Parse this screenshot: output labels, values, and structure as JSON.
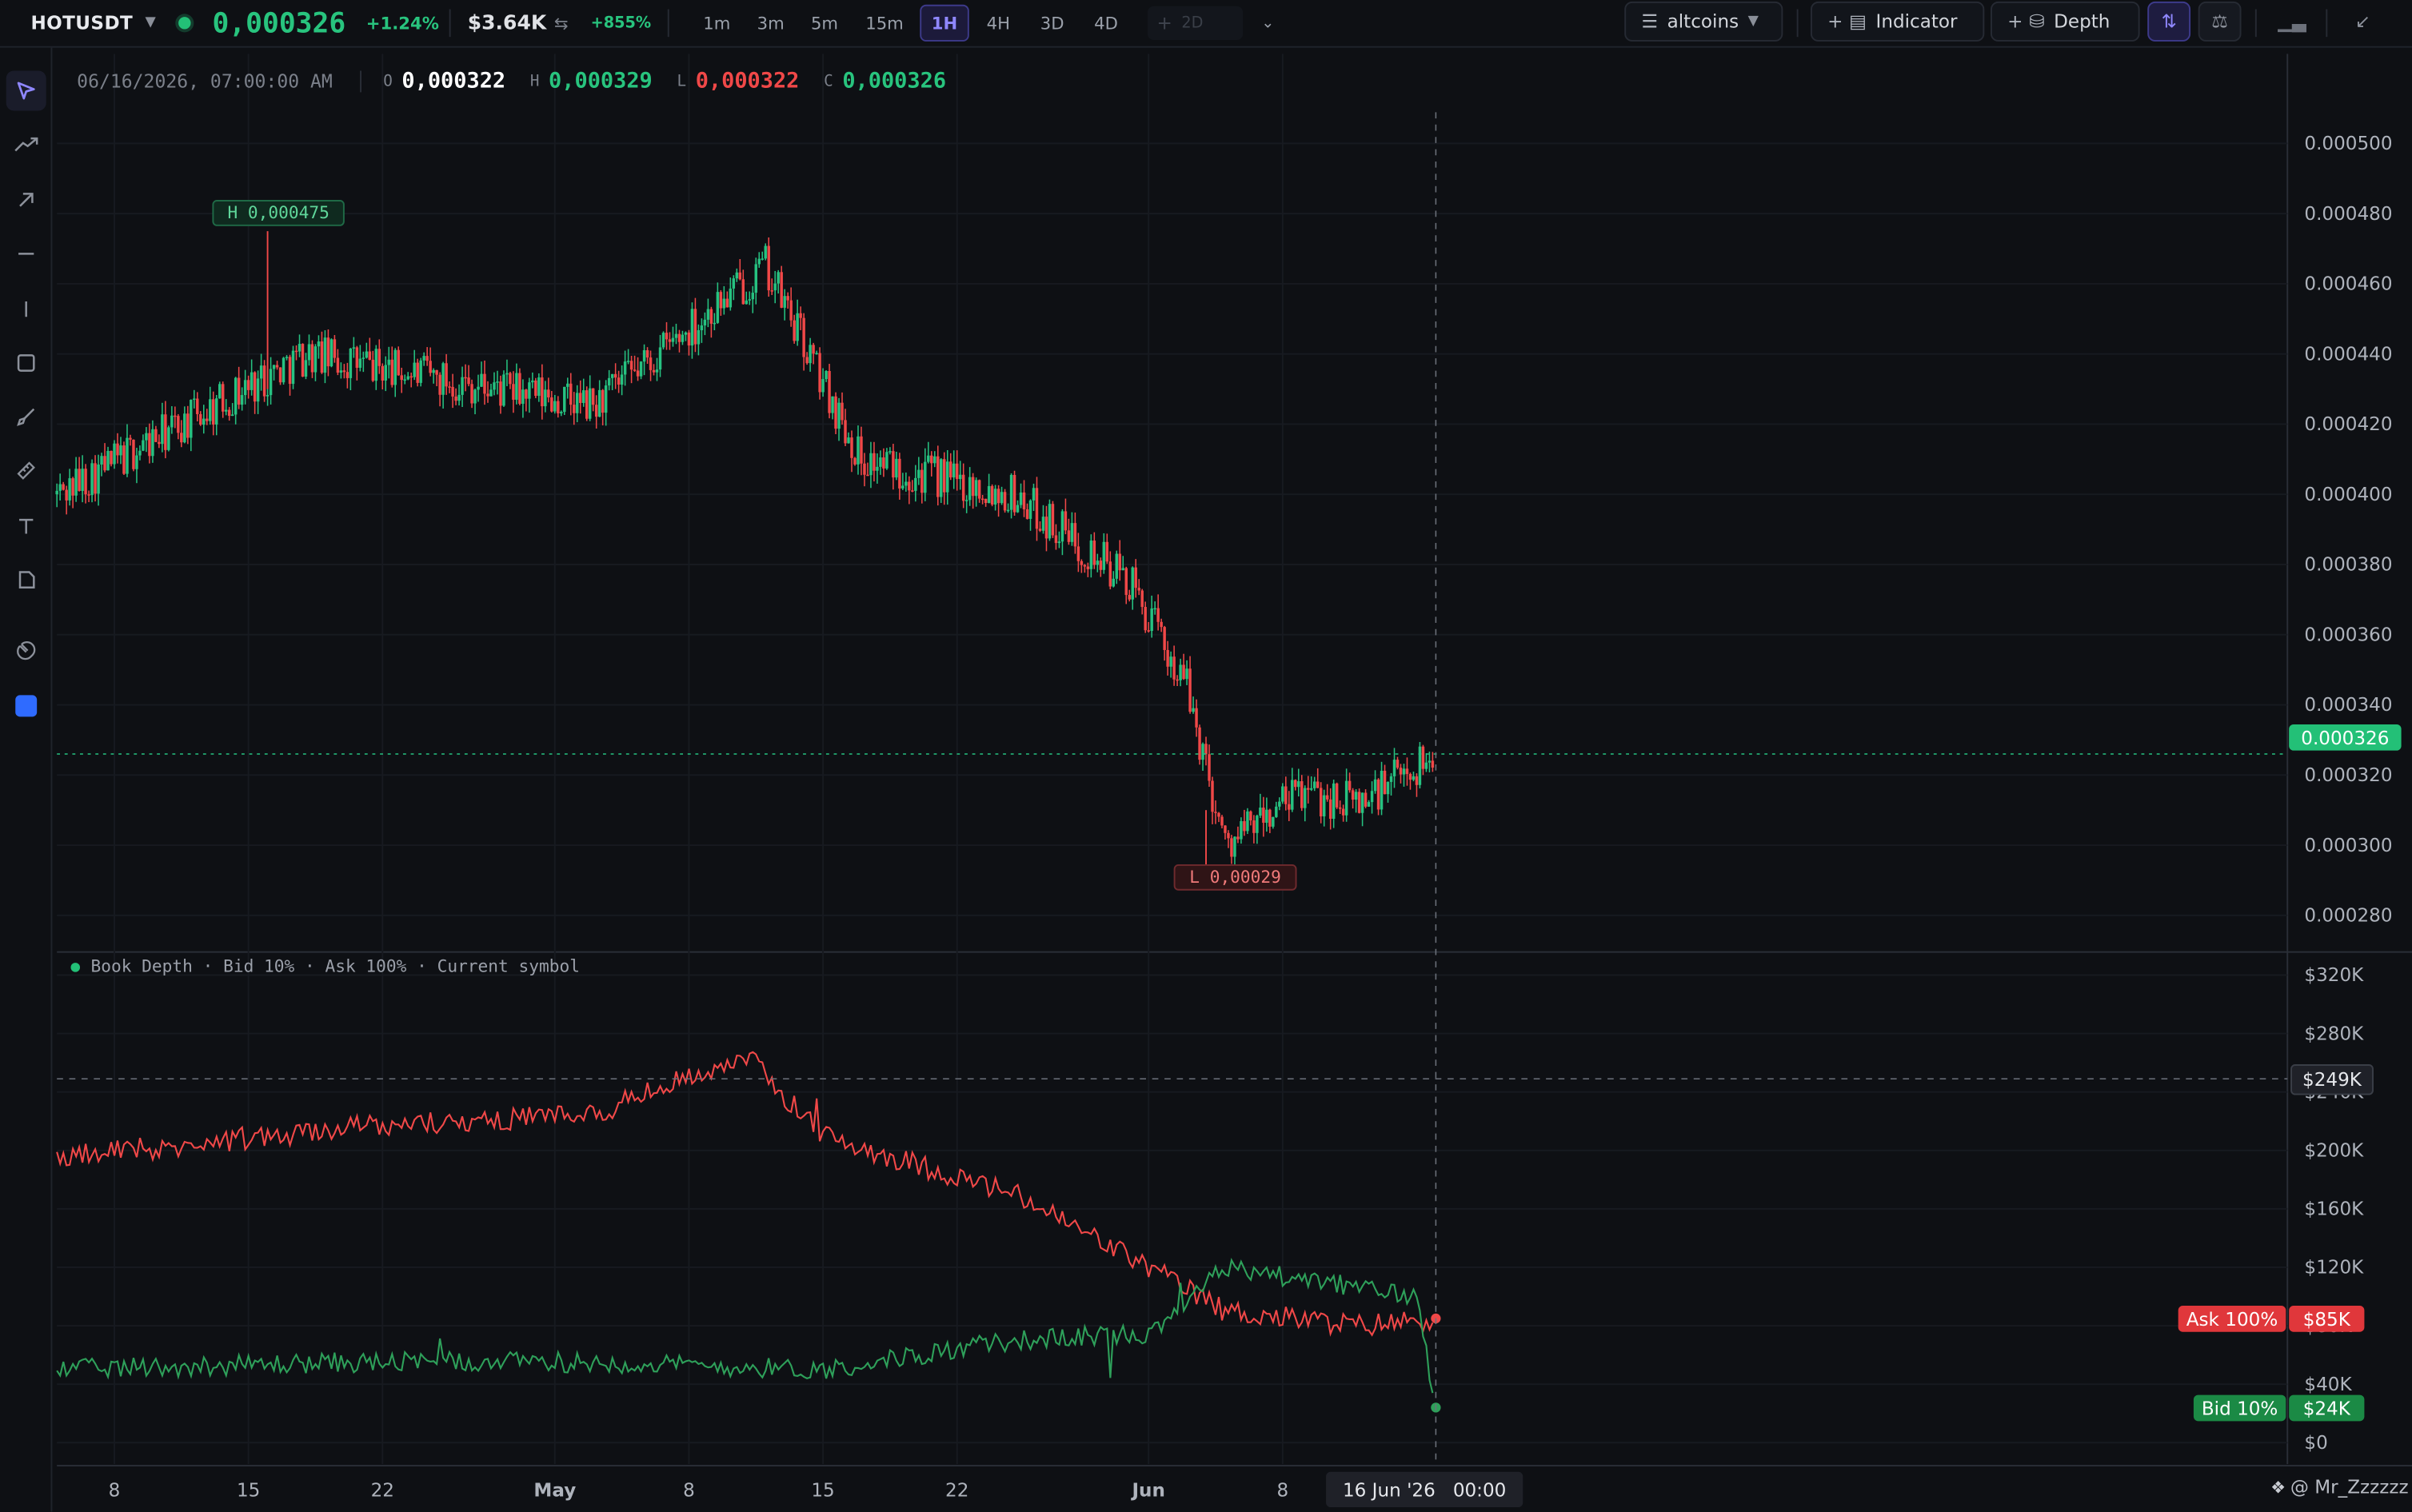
{
  "header": {
    "symbol": "HOTUSDT",
    "price": "0,000326",
    "change_pct": "+1.24%",
    "volume": "$3.64K",
    "volume_change": "+855%",
    "timeframes": [
      "1m",
      "3m",
      "5m",
      "15m",
      "1H",
      "4H",
      "3D",
      "4D"
    ],
    "active_timeframe": "1H",
    "add_timeframe": "2D",
    "category": "altcoins",
    "indicator_label": "Indicator",
    "depth_label": "Depth"
  },
  "ohlc": {
    "time": "06/16/2026, 07:00:00 AM",
    "o_label": "O",
    "o": "0,000322",
    "h_label": "H",
    "h": "0,000329",
    "l_label": "L",
    "l": "0,000322",
    "c_label": "C",
    "c": "0,000326"
  },
  "depth_legend": "Book Depth · Bid 10% · Ask 100% · Current symbol",
  "watermark": "@ Mr_Zzzzzz",
  "colors": {
    "up": "#26c281",
    "down": "#f04848",
    "ask": "#f04848",
    "bid": "#2ea05a",
    "accent": "#7b6cff",
    "background": "#0e1014"
  },
  "chart_data": [
    {
      "type": "candlestick",
      "series": [
        {
          "name": "HOTUSDT",
          "interval": "1H"
        }
      ],
      "x": [
        "2026-04-05",
        "2026-04-18",
        "2026-05-03",
        "2026-05-12",
        "2026-05-17",
        "2026-05-25",
        "2026-05-31",
        "2026-06-03",
        "2026-06-05",
        "2026-06-09",
        "2026-06-12",
        "2026-06-16"
      ],
      "close": [
        0.0004,
        0.00044,
        0.000425,
        0.000465,
        0.00041,
        0.0004,
        0.000375,
        0.000345,
        0.0003,
        0.000315,
        0.000312,
        0.000326
      ],
      "y_ticks": [
        "0.000500",
        "0.000480",
        "0.000460",
        "0.000440",
        "0.000420",
        "0.000400",
        "0.000380",
        "0.000360",
        "0.000340",
        "0.000320",
        "0.000300",
        "0.000280"
      ],
      "ylim": [
        0.00027,
        0.000508
      ],
      "last_price_label": "0.000326",
      "high_label": "H 0,000475",
      "low_label": "L 0,00029",
      "high": 0.000475,
      "low": 0.00029,
      "grid": true
    },
    {
      "type": "line",
      "title": "Book Depth · Bid 10% · Ask 100% · Current symbol",
      "series": [
        {
          "name": "Ask 100%",
          "x": [
            "2026-04-05",
            "2026-04-20",
            "2026-05-03",
            "2026-05-11",
            "2026-05-15",
            "2026-05-25",
            "2026-06-01",
            "2026-06-05",
            "2026-06-12",
            "2026-06-16"
          ],
          "values": [
            195000,
            215000,
            225000,
            265000,
            210000,
            170000,
            120000,
            90000,
            80000,
            85000
          ],
          "last_label": "$85K"
        },
        {
          "name": "Bid 10%",
          "x": [
            "2026-04-05",
            "2026-04-20",
            "2026-05-03",
            "2026-05-15",
            "2026-05-25",
            "2026-06-01",
            "2026-06-05",
            "2026-06-10",
            "2026-06-15",
            "2026-06-16"
          ],
          "values": [
            50000,
            55000,
            55000,
            50000,
            70000,
            75000,
            120000,
            110000,
            100000,
            24000
          ],
          "last_label": "$24K"
        }
      ],
      "y_ticks": [
        "$320K",
        "$280K",
        "$240K",
        "$200K",
        "$160K",
        "$120K",
        "$80K",
        "$40K",
        "$0"
      ],
      "ylim": [
        0,
        320000
      ],
      "crosshair_label": "$249K",
      "crosshair_value": 249000,
      "grid": true
    }
  ],
  "x_axis": {
    "ticks": [
      {
        "label": "8",
        "date": "2026-04-08"
      },
      {
        "label": "15",
        "date": "2026-04-15"
      },
      {
        "label": "22",
        "date": "2026-04-22"
      },
      {
        "label": "May",
        "date": "2026-05-01",
        "major": true
      },
      {
        "label": "8",
        "date": "2026-05-08"
      },
      {
        "label": "15",
        "date": "2026-05-15"
      },
      {
        "label": "22",
        "date": "2026-05-22"
      },
      {
        "label": "Jun",
        "date": "2026-06-01",
        "major": true
      },
      {
        "label": "8",
        "date": "2026-06-08"
      }
    ],
    "crosshair_label": "16 Jun '26   00:00"
  }
}
